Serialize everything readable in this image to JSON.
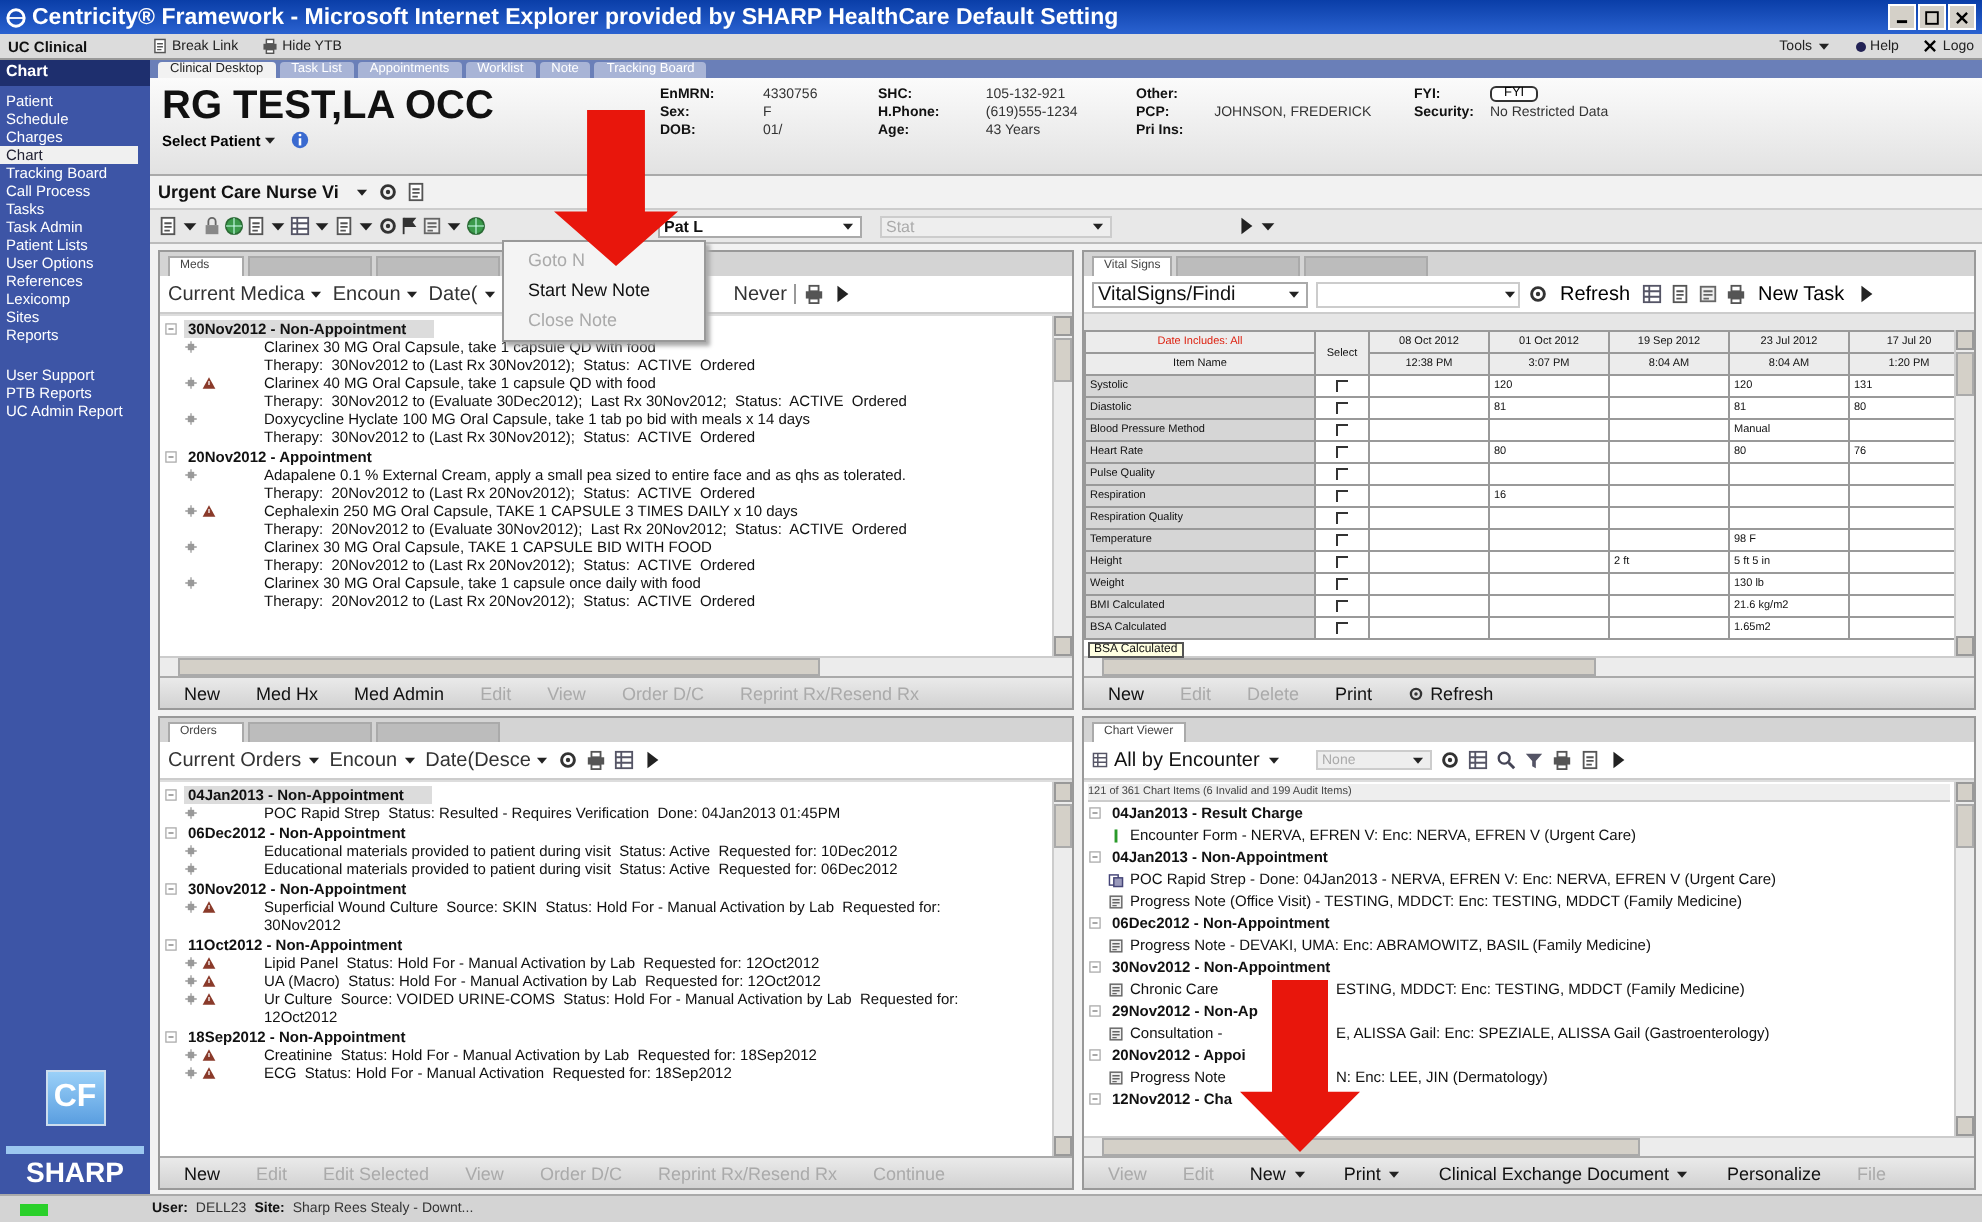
{
  "window": {
    "title": "Centricity® Framework - Microsoft Internet Explorer provided by SHARP HealthCare Default Setting"
  },
  "app_bar": {
    "app": "UC Clinical",
    "links": [
      "Break Link",
      "Hide YTB"
    ],
    "tools": "Tools",
    "help": "Help",
    "logoff": "Logo"
  },
  "sidebar": {
    "header": "Chart",
    "groups": [
      [
        {
          "label": "Patient",
          "selected": false
        },
        {
          "label": "Schedule",
          "selected": false
        },
        {
          "label": "Charges",
          "selected": false
        },
        {
          "label": "Chart",
          "selected": true
        },
        {
          "label": "Tracking Board",
          "selected": false
        },
        {
          "label": "Call Process",
          "selected": false
        },
        {
          "label": "Tasks",
          "selected": false
        },
        {
          "label": "Task Admin",
          "selected": false
        },
        {
          "label": "Patient Lists",
          "selected": false
        },
        {
          "label": "User Options",
          "selected": false
        },
        {
          "label": "References",
          "selected": false
        },
        {
          "label": "Lexicomp",
          "selected": false
        },
        {
          "label": "Sites",
          "selected": false
        },
        {
          "label": "Reports",
          "selected": false
        }
      ],
      [
        {
          "label": "User Support",
          "selected": false
        },
        {
          "label": "PTB Reports",
          "selected": false
        },
        {
          "label": "UC Admin Report",
          "selected": false
        }
      ]
    ],
    "logo_mark": "CF",
    "brand": "SHARP"
  },
  "tabs": [
    {
      "label": "Clinical Desktop",
      "selected": true
    },
    {
      "label": "Task List",
      "selected": false
    },
    {
      "label": "Appointments",
      "selected": false
    },
    {
      "label": "Worklist",
      "selected": false
    },
    {
      "label": "Note",
      "selected": false
    },
    {
      "label": "Tracking Board",
      "selected": false
    }
  ],
  "patient": {
    "name": "RG TEST,LA OCC",
    "select": "Select Patient",
    "columns": [
      [
        {
          "label": "EnMRN:",
          "value": "4330756"
        },
        {
          "label": "Sex:",
          "value": "F"
        },
        {
          "label": "DOB:",
          "value": "01/"
        }
      ],
      [
        {
          "label": "SHC:",
          "value": "105-132-921"
        },
        {
          "label": "H.Phone:",
          "value": "(619)555-1234"
        },
        {
          "label": "Age:",
          "value": "43 Years"
        }
      ],
      [
        {
          "label": "Other:"
        },
        {
          "label": "PCP:",
          "value": "JOHNSON, FREDERICK"
        },
        {
          "label": "Pri Ins:"
        }
      ],
      [
        {
          "label": "FYI:",
          "button": "FYI"
        },
        {
          "label": "Security:",
          "value": "No Restricted Data"
        }
      ]
    ]
  },
  "view": {
    "name": "Urgent Care Nurse Vi"
  },
  "toolbar": {
    "patient_list": "Pat L",
    "status": {
      "value": "Stat",
      "disabled": true
    }
  },
  "note_menu": [
    {
      "label": "Goto N",
      "disabled": true
    },
    {
      "label": "Start New Note",
      "disabled": false
    },
    {
      "label": "Close Note",
      "disabled": true
    }
  ],
  "meds_panel": {
    "tabs": [
      {
        "label": "Meds",
        "selected": true
      },
      {
        "selected": false
      },
      {
        "selected": false
      }
    ],
    "filters": [
      "Current Medica",
      "Encoun",
      "Date("
    ],
    "filter_tail": "Never",
    "groups": [
      {
        "title": "30Nov2012 - Non-Appointment",
        "selected": true,
        "items": [
          {
            "warning": false,
            "lines": [
              "Clarinex 30 MG Oral Capsule, take 1 capsule QD with food",
              "Therapy:  30Nov2012 to (Last Rx 30Nov2012);  Status:  ACTIVE  Ordered"
            ]
          },
          {
            "warning": true,
            "lines": [
              "Clarinex 40 MG Oral Capsule, take 1 capsule QD with food",
              "Therapy:  30Nov2012 to (Evaluate 30Dec2012);  Last Rx 30Nov2012;  Status:  ACTIVE  Ordered"
            ]
          },
          {
            "warning": false,
            "lines": [
              "Doxycycline Hyclate 100 MG Oral Capsule, take 1 tab po bid with meals x 14 days",
              "Therapy:  30Nov2012 to (Last Rx 30Nov2012);  Status:  ACTIVE  Ordered"
            ]
          }
        ]
      },
      {
        "title": "20Nov2012 - Appointment",
        "selected": false,
        "items": [
          {
            "warning": false,
            "lines": [
              "Adapalene 0.1 % External Cream, apply a small pea sized to entire face and as qhs as tolerated.",
              "Therapy:  20Nov2012 to (Last Rx 20Nov2012);  Status:  ACTIVE  Ordered"
            ]
          },
          {
            "warning": true,
            "lines": [
              "Cephalexin 250 MG Oral Capsule, TAKE 1 CAPSULE 3 TIMES DAILY x 10 days",
              "Therapy:  20Nov2012 to (Evaluate 30Nov2012);  Last Rx 20Nov2012;  Status:  ACTIVE  Ordered"
            ]
          },
          {
            "warning": false,
            "lines": [
              "Clarinex 30 MG Oral Capsule, TAKE 1 CAPSULE BID WITH FOOD",
              "Therapy:  20Nov2012 to (Last Rx 20Nov2012);  Status:  ACTIVE  Ordered"
            ]
          },
          {
            "warning": false,
            "lines": [
              "Clarinex 30 MG Oral Capsule, take 1 capsule once daily with food",
              "Therapy:  20Nov2012 to (Last Rx 20Nov2012);  Status:  ACTIVE  Ordered"
            ]
          }
        ]
      }
    ],
    "buttons": [
      {
        "label": "New",
        "disabled": false
      },
      {
        "label": "Med Hx",
        "disabled": false
      },
      {
        "label": "Med Admin",
        "disabled": false
      },
      {
        "label": "Edit",
        "disabled": true
      },
      {
        "label": "View",
        "disabled": true
      },
      {
        "label": "Order D/C",
        "disabled": true
      },
      {
        "label": "Reprint Rx/Resend Rx",
        "disabled": true
      }
    ]
  },
  "vitals_panel": {
    "tabs": [
      {
        "label": "Vital Signs",
        "selected": true
      },
      {
        "selected": false
      },
      {
        "selected": false
      }
    ],
    "view": "VitalSigns/Findi",
    "refresh": "Refresh",
    "new_task": "New Task",
    "table": {
      "filter": "Date Includes: All",
      "item": "Item Name",
      "select": "Select",
      "dates": [
        {
          "date": "08 Oct 2012",
          "time": "12:38 PM"
        },
        {
          "date": "01 Oct 2012",
          "time": "3:07 PM"
        },
        {
          "date": "19 Sep 2012",
          "time": "8:04 AM"
        },
        {
          "date": "23 Jul 2012",
          "time": "8:04 AM"
        },
        {
          "date": "17 Jul 20",
          "time": "1:20 PM"
        }
      ],
      "rows": [
        {
          "name": "Systolic",
          "checked": false,
          "cells": [
            {
              "blank": true
            },
            {
              "value": "120"
            },
            {
              "blank": true
            },
            {
              "value": "120"
            },
            {
              "value": "131"
            }
          ]
        },
        {
          "name": "Diastolic",
          "checked": false,
          "cells": [
            {
              "blank": true
            },
            {
              "value": "81"
            },
            {
              "blank": true
            },
            {
              "value": "81"
            },
            {
              "value": "80"
            }
          ]
        },
        {
          "name": "Blood Pressure Method",
          "checked": false,
          "cells": [
            {
              "blank": true
            },
            {
              "blank": true
            },
            {
              "blank": true
            },
            {
              "value": "Manual"
            },
            {
              "blank": true
            }
          ]
        },
        {
          "name": "Heart Rate",
          "checked": false,
          "cells": [
            {
              "blank": true
            },
            {
              "value": "80"
            },
            {
              "blank": true
            },
            {
              "value": "80"
            },
            {
              "value": "76"
            }
          ]
        },
        {
          "name": "Pulse Quality",
          "checked": false,
          "cells": [
            {
              "blank": true
            },
            {
              "blank": true
            },
            {
              "blank": true
            },
            {
              "blank": true
            },
            {
              "blank": true
            }
          ]
        },
        {
          "name": "Respiration",
          "checked": false,
          "cells": [
            {
              "blank": true
            },
            {
              "value": "16"
            },
            {
              "blank": true
            },
            {
              "blank": true
            },
            {
              "blank": true
            }
          ]
        },
        {
          "name": "Respiration Quality",
          "checked": false,
          "cells": [
            {
              "blank": true
            },
            {
              "blank": true
            },
            {
              "blank": true
            },
            {
              "blank": true
            },
            {
              "blank": true
            }
          ]
        },
        {
          "name": "Temperature",
          "checked": false,
          "cells": [
            {
              "blank": true
            },
            {
              "blank": true
            },
            {
              "blank": true
            },
            {
              "value": "98 F"
            },
            {
              "blank": true
            }
          ]
        },
        {
          "name": "Height",
          "checked": false,
          "cells": [
            {
              "blank": true
            },
            {
              "blank": true
            },
            {
              "value": "2 ft"
            },
            {
              "value": "5 ft 5 in"
            },
            {
              "blank": true
            }
          ]
        },
        {
          "name": "Weight",
          "checked": false,
          "cells": [
            {
              "blank": true
            },
            {
              "blank": true
            },
            {
              "blank": true
            },
            {
              "value": "130 lb"
            },
            {
              "blank": true
            }
          ]
        },
        {
          "name": "BMI Calculated",
          "checked": false,
          "cells": [
            {
              "blank": true
            },
            {
              "blank": true
            },
            {
              "blank": true
            },
            {
              "value": "21.6 kg/m2"
            },
            {
              "blank": true
            }
          ]
        },
        {
          "name": "BSA Calculated",
          "checked": false,
          "cells": [
            {
              "blank": true
            },
            {
              "blank": true
            },
            {
              "blank": true
            },
            {
              "value": "1.65m2"
            },
            {
              "blank": true
            }
          ]
        }
      ]
    },
    "tooltip": "BSA Calculated",
    "buttons": [
      {
        "label": "New",
        "disabled": false
      },
      {
        "label": "Edit",
        "disabled": true
      },
      {
        "label": "Delete",
        "disabled": true
      },
      {
        "label": "Print",
        "disabled": false
      },
      {
        "label": "Refresh",
        "disabled": false
      }
    ]
  },
  "orders_panel": {
    "tabs": [
      {
        "label": "Orders",
        "selected": true
      },
      {
        "selected": false
      },
      {
        "selected": false
      }
    ],
    "filters": [
      "Current Orders",
      "Encoun",
      "Date(Desce"
    ],
    "groups": [
      {
        "title": "04Jan2013 - Non-Appointment",
        "selected": true,
        "items": [
          {
            "warning": false,
            "lines": [
              "POC Rapid Strep  Status: Resulted - Requires Verification  Done: 04Jan2013 01:45PM"
            ]
          }
        ]
      },
      {
        "title": "06Dec2012 - Non-Appointment",
        "selected": false,
        "items": [
          {
            "warning": false,
            "lines": [
              "Educational materials provided to patient during visit  Status: Active  Requested for: 10Dec2012"
            ]
          },
          {
            "warning": false,
            "lines": [
              "Educational materials provided to patient during visit  Status: Active  Requested for: 06Dec2012"
            ]
          }
        ]
      },
      {
        "title": "30Nov2012 - Non-Appointment",
        "selected": false,
        "items": [
          {
            "warning": true,
            "lines": [
              "Superficial Wound Culture  Source: SKIN  Status: Hold For - Manual Activation by Lab  Requested for:",
              "30Nov2012"
            ]
          }
        ]
      },
      {
        "title": "11Oct2012 - Non-Appointment",
        "selected": false,
        "items": [
          {
            "warning": true,
            "lines": [
              "Lipid Panel  Status: Hold For - Manual Activation by Lab  Requested for: 12Oct2012"
            ]
          },
          {
            "warning": true,
            "lines": [
              "UA (Macro)  Status: Hold For - Manual Activation by Lab  Requested for: 12Oct2012"
            ]
          },
          {
            "warning": true,
            "lines": [
              "Ur Culture  Source: VOIDED URINE-COMS  Status: Hold For - Manual Activation by Lab  Requested for:",
              "12Oct2012"
            ]
          }
        ]
      },
      {
        "title": "18Sep2012 - Non-Appointment",
        "selected": false,
        "items": [
          {
            "warning": true,
            "lines": [
              "Creatinine  Status: Hold For - Manual Activation by Lab  Requested for: 18Sep2012"
            ]
          },
          {
            "warning": true,
            "lines": [
              "ECG  Status: Hold For - Manual Activation  Requested for: 18Sep2012"
            ]
          }
        ]
      }
    ],
    "buttons": [
      {
        "label": "New",
        "disabled": false
      },
      {
        "label": "Edit",
        "disabled": true
      },
      {
        "label": "Edit Selected",
        "disabled": true
      },
      {
        "label": "View",
        "disabled": true
      },
      {
        "label": "Order D/C",
        "disabled": true
      },
      {
        "label": "Reprint Rx/Resend Rx",
        "disabled": true
      },
      {
        "label": "Continue",
        "disabled": true
      }
    ]
  },
  "chart_viewer": {
    "tabs": [
      {
        "label": "Chart Viewer",
        "selected": true
      }
    ],
    "view": "All by Encounter",
    "filter": {
      "value": "None",
      "disabled": true
    },
    "summary": "121 of 361 Chart Items (6 Invalid and 199 Audit Items)",
    "groups": [
      {
        "title": "04Jan2013 - Result Charge",
        "items": [
          {
            "kind": "form",
            "parts": [
              "Encounter Form - NERVA, EFREN V: Enc: NERVA, EFREN V (Urgent Care)"
            ]
          }
        ]
      },
      {
        "title": "04Jan2013 - Non-Appointment",
        "items": [
          {
            "kind": "result",
            "parts": [
              "POC Rapid Strep - Done: 04Jan2013 - NERVA, EFREN V: Enc: NERVA, EFREN V (Urgent Care)"
            ]
          },
          {
            "kind": "note",
            "parts": [
              "Progress Note (Office Visit) - TESTING, MDDCT: Enc: TESTING, MDDCT (Family Medicine)"
            ]
          }
        ]
      },
      {
        "title": "06Dec2012 - Non-Appointment",
        "items": [
          {
            "kind": "note",
            "parts": [
              "Progress Note - DEVAKI, UMA: Enc: ABRAMOWITZ, BASIL (Family Medicine)"
            ]
          }
        ]
      },
      {
        "title": "30Nov2012 - Non-Appointment",
        "items": [
          {
            "kind": "note",
            "parts": [
              "Chronic Care",
              "ESTING, MDDCT: Enc: TESTING, MDDCT (Family Medicine)"
            ]
          }
        ]
      },
      {
        "title": "29Nov2012 - Non-Ap",
        "items": [
          {
            "kind": "note",
            "parts": [
              "Consultation -",
              "E, ALISSA Gail: Enc: SPEZIALE, ALISSA Gail (Gastroenterology)"
            ]
          }
        ]
      },
      {
        "title": "20Nov2012 - Appoi",
        "items": [
          {
            "kind": "note",
            "parts": [
              "Progress Note",
              "N: Enc: LEE, JIN (Dermatology)"
            ]
          }
        ]
      },
      {
        "title": "12Nov2012 - Cha"
      }
    ],
    "buttons": [
      {
        "label": "View",
        "disabled": true,
        "menu": false
      },
      {
        "label": "Edit",
        "disabled": true,
        "menu": false
      },
      {
        "label": "New",
        "disabled": false,
        "menu": true
      },
      {
        "label": "Print",
        "disabled": false,
        "menu": true
      },
      {
        "label": "Clinical Exchange Document",
        "disabled": false,
        "menu": true
      },
      {
        "label": "Personalize",
        "disabled": false,
        "menu": false
      },
      {
        "label": "File",
        "disabled": true,
        "menu": false
      }
    ]
  },
  "status_bar": {
    "user_label": "User:",
    "user": "DELL23",
    "site_label": "Site:",
    "site": "Sharp Rees Stealy - Downt..."
  }
}
